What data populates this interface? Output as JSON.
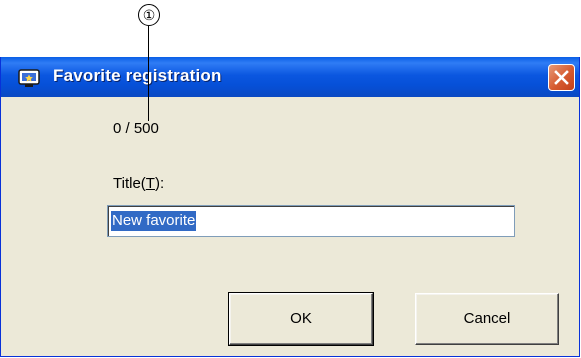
{
  "annotation": {
    "callout_number": "①"
  },
  "dialog": {
    "title": "Favorite registration",
    "counter": "0 / 500",
    "title_label": "Title(",
    "title_label_accel": "T",
    "title_label_end": "):",
    "title_value": "New favorite",
    "ok_label": "OK",
    "cancel_label": "Cancel"
  },
  "colors": {
    "titlebar": "#0a5ee6",
    "dialog_bg": "#ece9d8",
    "selection": "#316ac5",
    "close_button": "#d65a2f"
  },
  "icons": {
    "title_icon": "favorite-icon",
    "close_icon": "close-icon"
  }
}
